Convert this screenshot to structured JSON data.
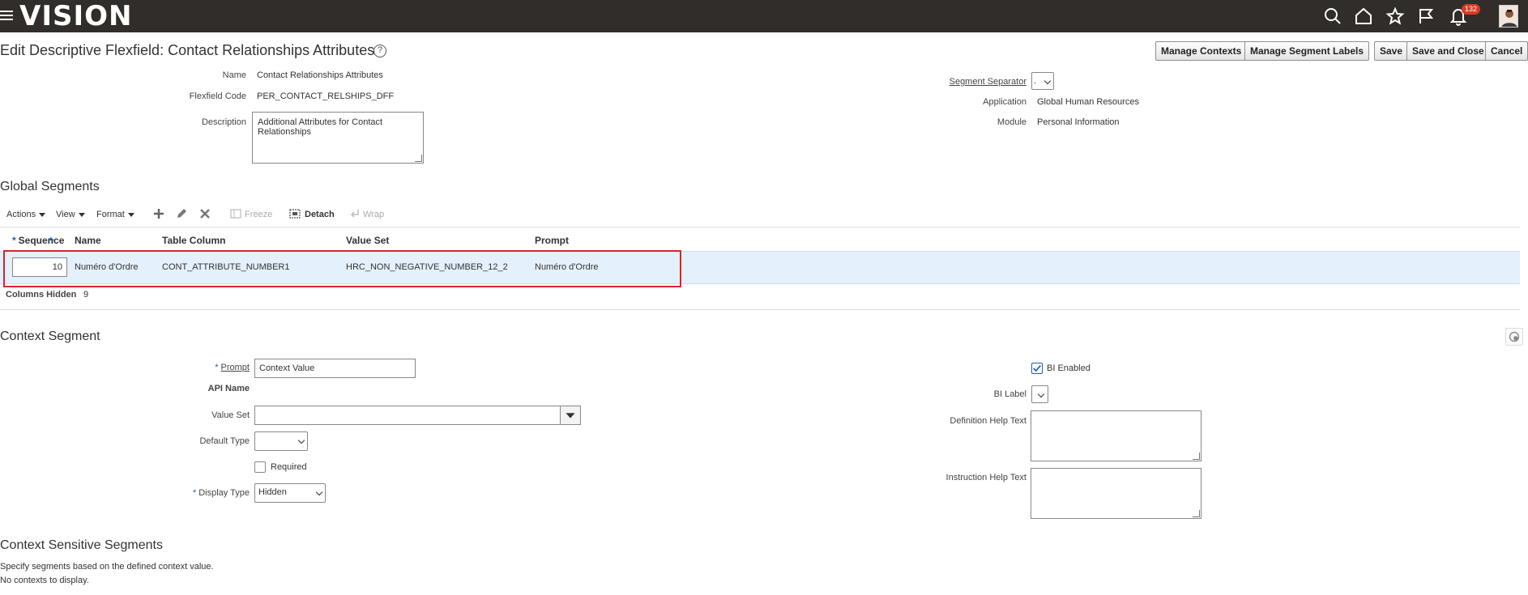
{
  "header": {
    "logo": "VISION",
    "notification_count": "132",
    "icons": [
      "hamburger-icon",
      "search-icon",
      "home-icon",
      "favorites-icon",
      "flag-icon",
      "bell-icon",
      "avatar"
    ]
  },
  "page": {
    "title": "Edit Descriptive Flexfield: Contact Relationships Attributes",
    "help": "?",
    "buttons": {
      "manage_contexts": "Manage Contexts",
      "manage_segment_labels": "Manage Segment Labels",
      "save": "Save",
      "save_and_close": "Save and Close",
      "cancel": "Cancel"
    }
  },
  "details": {
    "name_label": "Name",
    "name_value": "Contact Relationships Attributes",
    "code_label": "Flexfield Code",
    "code_value": "PER_CONTACT_RELSHIPS_DFF",
    "desc_label": "Description",
    "desc_value": "Additional Attributes for Contact Relationships",
    "separator_label": "Segment Separator",
    "separator_value": ".",
    "application_label": "Application",
    "application_value": "Global Human Resources",
    "module_label": "Module",
    "module_value": "Personal Information"
  },
  "global_segments": {
    "title": "Global Segments",
    "toolbar": {
      "actions": "Actions",
      "view": "View",
      "format": "Format",
      "freeze": "Freeze",
      "detach": "Detach",
      "wrap": "Wrap"
    },
    "columns": {
      "sequence": "Sequence",
      "name": "Name",
      "table_column": "Table Column",
      "value_set": "Value Set",
      "prompt": "Prompt"
    },
    "rows": [
      {
        "sequence": "10",
        "name": "Numéro d'Ordre",
        "table_column": "CONT_ATTRIBUTE_NUMBER1",
        "value_set": "HRC_NON_NEGATIVE_NUMBER_12_2",
        "prompt": "Numéro d'Ordre"
      }
    ],
    "columns_hidden_label": "Columns Hidden",
    "columns_hidden_value": "9"
  },
  "context_segment": {
    "title": "Context Segment",
    "prompt_label": "Prompt",
    "prompt_value": "Context Value",
    "api_name_label": "API Name",
    "value_set_label": "Value Set",
    "value_set_value": "",
    "default_type_label": "Default Type",
    "default_type_value": "",
    "required_label": "Required",
    "display_type_label": "Display Type",
    "display_type_value": "Hidden",
    "bi_enabled_label": "BI Enabled",
    "bi_label_label": "BI Label",
    "bi_label_value": "",
    "definition_help_label": "Definition Help Text",
    "instruction_help_label": "Instruction Help Text"
  },
  "context_sensitive": {
    "title": "Context Sensitive Segments",
    "line1": "Specify segments based on the defined context value.",
    "line2": "No contexts to display."
  },
  "colors": {
    "topbar": "#312d2a",
    "selected_row": "#e4f0fb",
    "highlight_border": "#d7262a",
    "badge": "#d63b25"
  }
}
